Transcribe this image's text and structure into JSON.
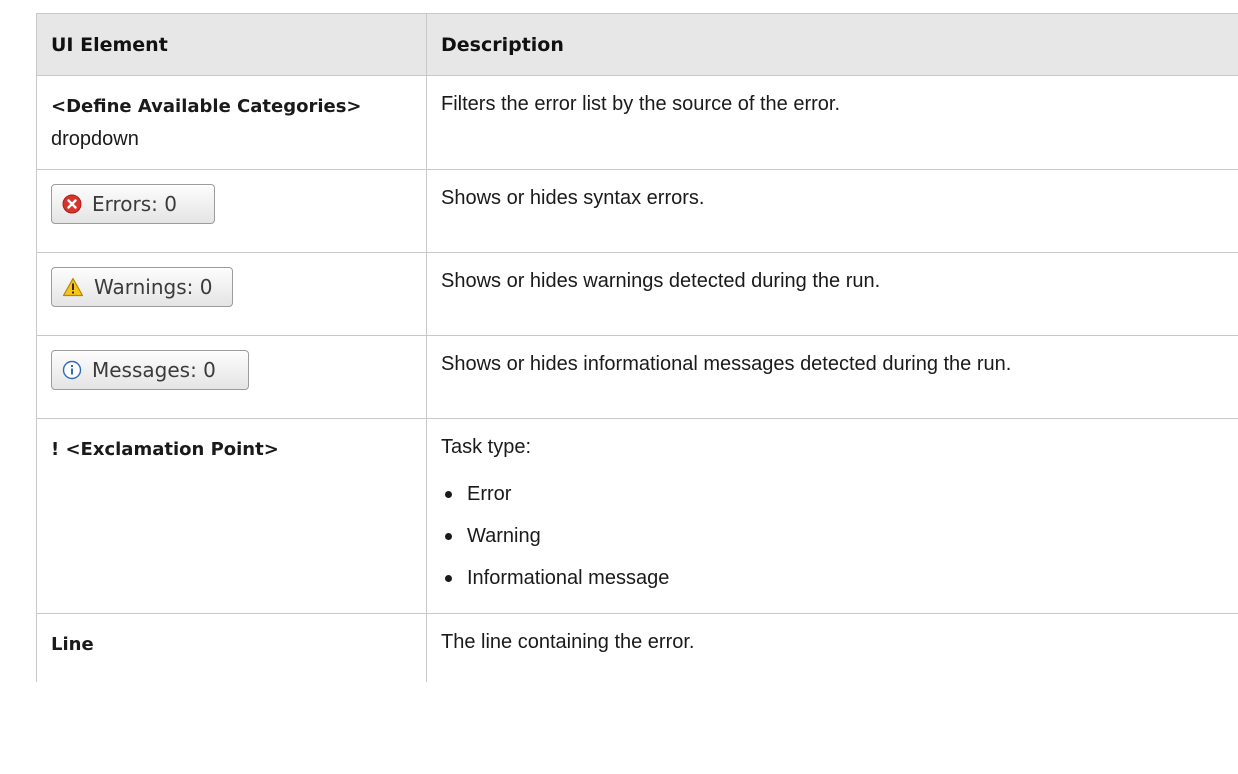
{
  "header": {
    "col1": "UI Element",
    "col2": "Description"
  },
  "rows": [
    {
      "element_bold": "<Define Available Categories>",
      "element_rest": "dropdown",
      "description": "Filters the error list by the source of the error."
    },
    {
      "button_label": "Errors: 0",
      "icon": "error-icon",
      "description": "Shows or hides syntax errors."
    },
    {
      "button_label": "Warnings: 0",
      "icon": "warning-icon",
      "description": "Shows or hides warnings detected during the run."
    },
    {
      "button_label": "Messages: 0",
      "icon": "info-icon",
      "description": "Shows or hides informational messages detected during the run."
    },
    {
      "element_bold": "! <Exclamation Point>",
      "description": "Task type:",
      "bullets": [
        "Error",
        "Warning",
        "Informational message"
      ]
    },
    {
      "element_bold": "Line",
      "description": "The line containing the error."
    }
  ],
  "colors": {
    "header_bg": "#e7e7e7",
    "border": "#c8c8c8",
    "error_red": "#d9342b",
    "warning_yellow": "#f5c518",
    "info_blue": "#2f6db5"
  }
}
